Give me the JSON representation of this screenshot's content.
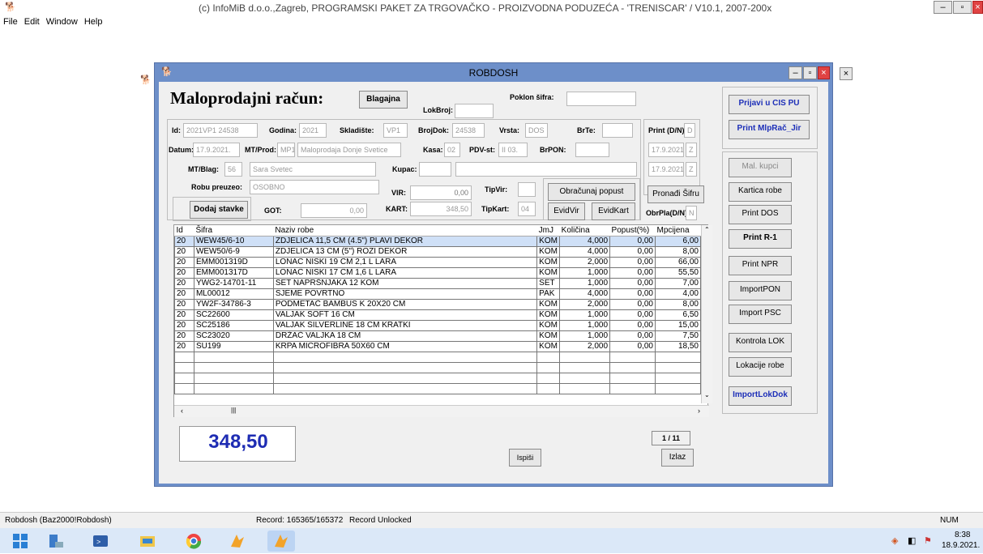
{
  "app": {
    "title": "(c) InfoMiB d.o.o.,Zagreb, PROGRAMSKI PAKET ZA TRGOVAČKO - PROIZVODNA PODUZEĆA - 'TRENISCAR' / V10.1, 2007-200x",
    "menu": [
      "File",
      "Edit",
      "Window",
      "Help"
    ]
  },
  "window": {
    "title": "ROBDOSH"
  },
  "form": {
    "heading": "Maloprodajni račun:",
    "blagajna_btn": "Blagajna",
    "lokbroj_label": "LokBroj:",
    "poklon_label": "Poklon šifra:",
    "id_label": "Id:",
    "id_value": "2021VP1 24538",
    "godina_label": "Godina:",
    "godina_value": "2021",
    "skladiste_label": "Skladište:",
    "skladiste_value": "VP1",
    "brojdok_label": "BrojDok:",
    "brojdok_value": "24538",
    "vrsta_label": "Vrsta:",
    "vrsta_value": "DOS",
    "brte_label": "BrTe:",
    "print_label": "Print (D/N):",
    "print_value": "D",
    "datum_label": "Datum:",
    "datum_value": "17.9.2021.",
    "mtprod_label": "MT/Prod:",
    "mtprod_value": "MP1",
    "mtprod_desc": "Maloprodaja Donje Svetice",
    "kasa_label": "Kasa:",
    "kasa_value": "02",
    "pdvst_label": "PDV-st:",
    "pdvst_value": "II 03.",
    "brpon_label": "BrPON:",
    "date2": "17.9.2021.",
    "z1": "Z",
    "mtblag_label": "MT/Blag:",
    "mtblag_value": "56",
    "mtblag_desc": "Sara Svetec",
    "kupac_label": "Kupac:",
    "date3": "17.9.2021.",
    "z2": "Z",
    "robu_label": "Robu preuzeo:",
    "robu_value": "OSOBNO",
    "vir_label": "VIR:",
    "vir_value": "0,00",
    "tipvir_label": "TipVir:",
    "obracunaj_btn": "Obračunaj popust",
    "pronadi_btn": "Pronađi Šifru",
    "dodaj_btn": "Dodaj stavke",
    "got_label": "GOT:",
    "got_value": "0,00",
    "kart_label": "KART:",
    "kart_value": "348,50",
    "tipkart_label": "TipKart:",
    "tipkart_value": "04",
    "evidvir_btn": "EvidVir",
    "evidkart_btn": "EvidKart",
    "obrpla_label": "ObrPla(D/N):",
    "obrpla_value": "N",
    "total": "348,50",
    "pager": "1 / 11",
    "ispisi_btn": "Ispiši",
    "izlaz_btn": "Izlaz"
  },
  "side_buttons": [
    "Prijavi u CIS PU",
    "Print MlpRač_Jir",
    "Mal. kupci",
    "Kartica robe",
    "Print DOS",
    "Print R-1",
    "Print NPR",
    "ImportPON",
    "Import PSC",
    "Kontrola LOK",
    "Lokacije robe",
    "ImportLokDok"
  ],
  "grid": {
    "columns": [
      "Id",
      "Šifra",
      "Naziv robe",
      "JmJ",
      "Količina",
      "Popust(%)",
      "Mpcijena"
    ],
    "rows": [
      [
        "20",
        "WEW45/6-10",
        "ZDJELICA 11,5 CM (4.5\") PLAVI DEKOR",
        "KOM",
        "4,000",
        "0,00",
        "6,00"
      ],
      [
        "20",
        "WEW50/6-9",
        "ZDJELICA 13 CM (5\") ROZI DEKOR",
        "KOM",
        "4,000",
        "0,00",
        "8,00"
      ],
      [
        "20",
        "EMM001319D",
        "LONAC NISKI 19 CM 2,1 L LARA",
        "KOM",
        "2,000",
        "0,00",
        "66,00"
      ],
      [
        "20",
        "EMM001317D",
        "LONAC NISKI 17 CM 1,6 L LARA",
        "KOM",
        "1,000",
        "0,00",
        "55,50"
      ],
      [
        "20",
        "YWG2-14701-11",
        "SET NAPRŠNJAKA 12 KOM",
        "SET",
        "1,000",
        "0,00",
        "7,00"
      ],
      [
        "20",
        "ML00012",
        "SJEME POVRTNO",
        "PAK",
        "4,000",
        "0,00",
        "4,00"
      ],
      [
        "20",
        "YW2F-34786-3",
        "PODMETAČ BAMBUS K 20X20 CM",
        "KOM",
        "2,000",
        "0,00",
        "8,00"
      ],
      [
        "20",
        "SC22600",
        "VALJAK SOFT 16 CM",
        "KOM",
        "1,000",
        "0,00",
        "6,50"
      ],
      [
        "20",
        "SC25186",
        "VALJAK SILVERLINE 18 CM KRATKI",
        "KOM",
        "1,000",
        "0,00",
        "15,00"
      ],
      [
        "20",
        "SC23020",
        "DRŽAČ VALJKA 18 CM",
        "KOM",
        "1,000",
        "0,00",
        "7,50"
      ],
      [
        "20",
        "SU199",
        "KRPA MICROFIBRA 50X60 CM",
        "KOM",
        "2,000",
        "0,00",
        "18,50"
      ]
    ]
  },
  "status": {
    "left": "Robdosh (Baz2000!Robdosh)",
    "record": "Record: 165365/165372",
    "lock": "Record Unlocked",
    "num": "NUM"
  },
  "clock": {
    "time": "8:38",
    "date": "18.9.2021."
  }
}
